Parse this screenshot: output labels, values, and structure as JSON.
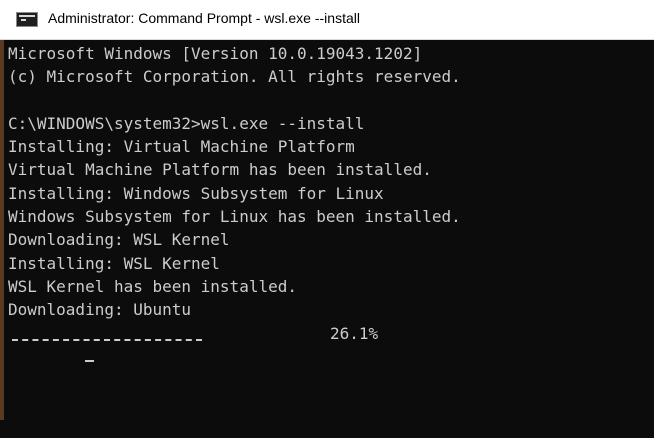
{
  "window": {
    "title": "Administrator: Command Prompt - wsl.exe  --install",
    "icon": "cmd-console-icon"
  },
  "console": {
    "lines": [
      "Microsoft Windows [Version 10.0.19043.1202]",
      "(c) Microsoft Corporation. All rights reserved.",
      "",
      "C:\\WINDOWS\\system32>wsl.exe --install",
      "Installing: Virtual Machine Platform",
      "Virtual Machine Platform has been installed.",
      "Installing: Windows Subsystem for Linux",
      "Windows Subsystem for Linux has been installed.",
      "Downloading: WSL Kernel",
      "Installing: WSL Kernel",
      "WSL Kernel has been installed.",
      "Downloading: Ubuntu"
    ],
    "progress": {
      "percent_label": "26.1%",
      "fraction": 0.261
    },
    "colors": {
      "background": "#0c0c0c",
      "text": "#cccccc"
    }
  }
}
